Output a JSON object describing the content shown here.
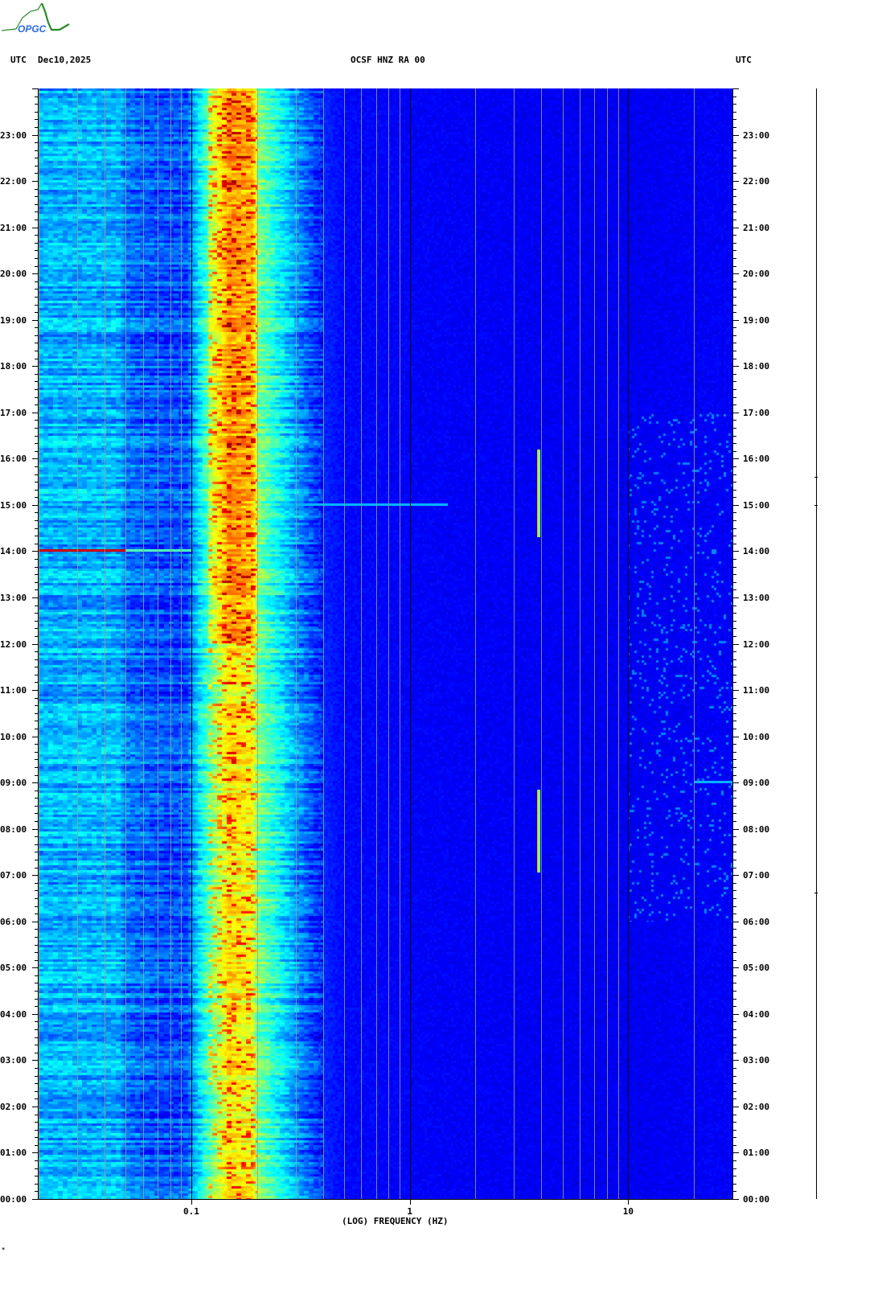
{
  "header": {
    "logo_text": "OPGC",
    "left_label": "UTC",
    "date": "Dec10,2025",
    "title": "OCSF HNZ RA 00",
    "right_label": "UTC"
  },
  "footer_mark": "*",
  "chart_data": {
    "type": "heatmap",
    "title": "OCSF HNZ RA 00",
    "xlabel": "(LOG) FREQUENCY (HZ)",
    "ylabel": "UTC",
    "x_scale": "log",
    "xlim": [
      0.02,
      30
    ],
    "ylim_hours": [
      0,
      24
    ],
    "x_ticks": [
      {
        "value": 0.1,
        "label": "0.1"
      },
      {
        "value": 1,
        "label": "1"
      },
      {
        "value": 10,
        "label": "10"
      }
    ],
    "y_ticks": [
      "00:00",
      "01:00",
      "02:00",
      "03:00",
      "04:00",
      "05:00",
      "06:00",
      "07:00",
      "08:00",
      "09:00",
      "10:00",
      "11:00",
      "12:00",
      "13:00",
      "14:00",
      "15:00",
      "16:00",
      "17:00",
      "18:00",
      "19:00",
      "20:00",
      "21:00",
      "22:00",
      "23:00"
    ],
    "colormap": "jet",
    "mean_spectral_level": [
      [
        0.02,
        0.3
      ],
      [
        0.047,
        0.3
      ],
      [
        0.05,
        0.24
      ],
      [
        0.075,
        0.2
      ],
      [
        0.095,
        0.2
      ],
      [
        0.1,
        0.26
      ],
      [
        0.125,
        0.5
      ],
      [
        0.15,
        0.66
      ],
      [
        0.19,
        0.62
      ],
      [
        0.2,
        0.5
      ],
      [
        0.25,
        0.38
      ],
      [
        0.3,
        0.28
      ],
      [
        0.38,
        0.17
      ],
      [
        0.5,
        0.13
      ],
      [
        1,
        0.12
      ],
      [
        10,
        0.11
      ],
      [
        30,
        0.12
      ]
    ],
    "events": [
      {
        "type": "horizontal",
        "hour": 14.0,
        "f_from": 0.02,
        "f_to": 0.05,
        "level": 0.92
      },
      {
        "type": "horizontal",
        "hour": 14.0,
        "f_from": 0.05,
        "f_to": 0.1,
        "level": 0.45
      },
      {
        "type": "horizontal",
        "hour": 15.0,
        "f_from": 0.3,
        "f_to": 1.5,
        "level": 0.3
      },
      {
        "type": "horizontal",
        "hour": 9.0,
        "f_from": 20,
        "f_to": 30,
        "level": 0.3
      },
      {
        "type": "vertical",
        "freq": 3.85,
        "hour_from": 14.3,
        "hour_to": 16.2,
        "level": 0.7
      },
      {
        "type": "vertical",
        "freq": 3.85,
        "hour_from": 7.05,
        "hour_to": 8.85,
        "level": 0.7
      }
    ],
    "reference_lines_hz": [
      0.02,
      0.03,
      0.04,
      0.05,
      0.06,
      0.07,
      0.08,
      0.09,
      0.1,
      0.2,
      0.3,
      0.4,
      0.5,
      0.6,
      0.7,
      0.8,
      0.9,
      1,
      2,
      3,
      4,
      5,
      6,
      7,
      8,
      9,
      10,
      20,
      30
    ],
    "colors": {
      "major_line": "#000000",
      "minor_line": "#a0a080"
    }
  }
}
